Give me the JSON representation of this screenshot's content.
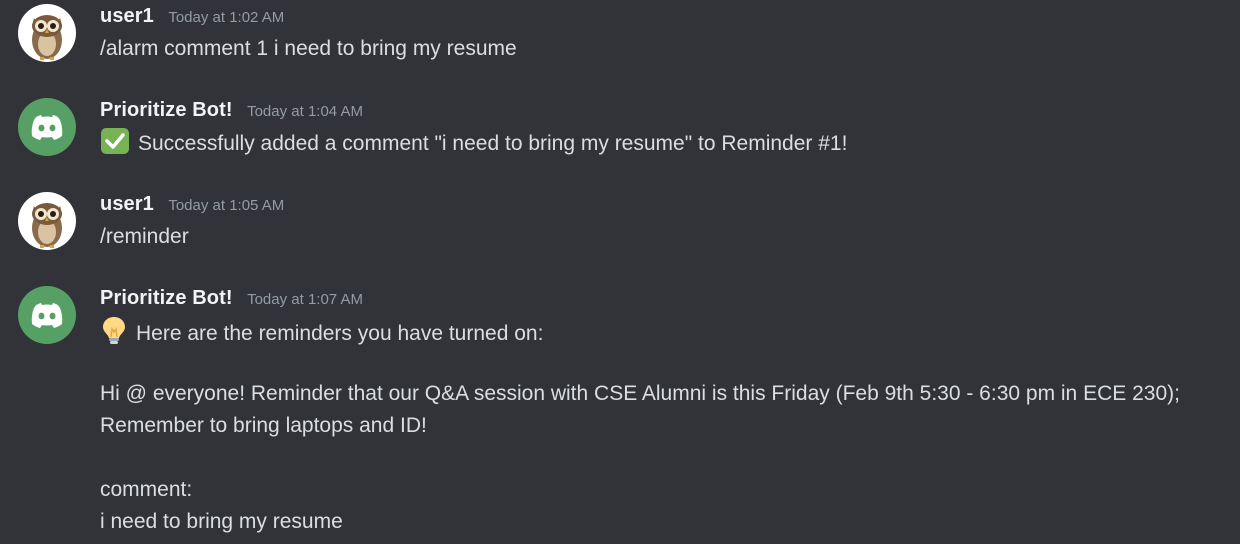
{
  "messages": [
    {
      "author": "user1",
      "timestamp": "Today at 1:02 AM",
      "avatar": "owl-avatar",
      "lines": [
        "/alarm comment 1 i need to bring my resume"
      ]
    },
    {
      "author": "Prioritize Bot!",
      "timestamp": "Today at 1:04 AM",
      "avatar": "discord-logo-avatar",
      "emoji": "check-mark-button-icon",
      "lines": [
        "Successfully added a comment \"i need to bring my resume\" to Reminder #1!"
      ]
    },
    {
      "author": "user1",
      "timestamp": "Today at 1:05 AM",
      "avatar": "owl-avatar",
      "lines": [
        "/reminder"
      ]
    },
    {
      "author": "Prioritize Bot!",
      "timestamp": "Today at 1:07 AM",
      "avatar": "discord-logo-avatar",
      "emoji": "light-bulb-icon",
      "lines": [
        "Here are the reminders you have turned on:",
        "Hi @ everyone! Reminder that our Q&A session with CSE Alumni is this Friday  (Feb 9th 5:30 - 6:30 pm in ECE 230); Remember to bring laptops and ID!",
        "comment:",
        "i need to bring my resume"
      ]
    }
  ],
  "colors": {
    "background": "#313338",
    "username": "#f2f3f5",
    "timestamp": "#949ba4",
    "text": "#dbdee1",
    "bot_avatar": "#57a065"
  }
}
